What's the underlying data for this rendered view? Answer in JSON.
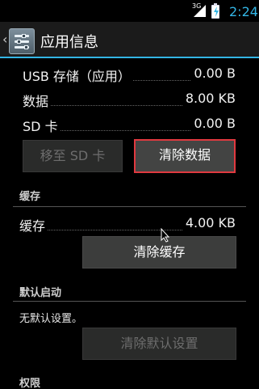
{
  "status_bar": {
    "network": "3G",
    "time": "2:24",
    "icons": [
      "signal-icon",
      "battery-charging-icon"
    ]
  },
  "action_bar": {
    "title": "应用信息",
    "icons": [
      "up-caret-icon",
      "settings-app-icon"
    ]
  },
  "storage": {
    "rows": [
      {
        "label": "USB 存储（应用）",
        "value": "0.00 B"
      },
      {
        "label": "数据",
        "value": "8.00 KB"
      },
      {
        "label": "SD 卡",
        "value": "0.00 B"
      }
    ],
    "move_button": "移至 SD 卡",
    "clear_data_button": "清除数据"
  },
  "cache": {
    "header": "缓存",
    "label": "缓存",
    "value": "4.00 KB",
    "clear_cache_button": "清除缓存"
  },
  "defaults": {
    "header": "默认启动",
    "note": "无默认设置。",
    "clear_defaults_button": "清除默认设置"
  },
  "permissions": {
    "header": "权限"
  },
  "colors": {
    "accent": "#33b5e5",
    "focus_border": "#e0393f",
    "background": "#000000"
  }
}
